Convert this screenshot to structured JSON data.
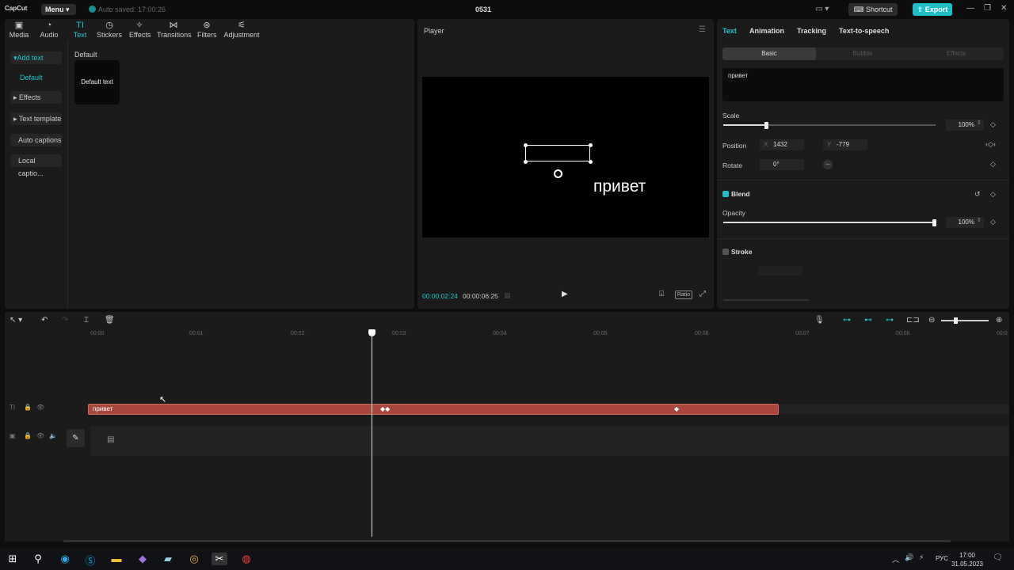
{
  "titlebar": {
    "logo": "CapCut",
    "menu_label": "Menu",
    "autosave": "Auto saved: 17:00:26",
    "project_title": "0531",
    "shortcut_label": "Shortcut",
    "export_label": "Export"
  },
  "toolbar": {
    "items": [
      {
        "label": "Media",
        "icon": "media-icon"
      },
      {
        "label": "Audio",
        "icon": "audio-icon"
      },
      {
        "label": "Text",
        "icon": "text-icon",
        "active": true
      },
      {
        "label": "Stickers",
        "icon": "stickers-icon"
      },
      {
        "label": "Effects",
        "icon": "effects-icon"
      },
      {
        "label": "Transitions",
        "icon": "transitions-icon"
      },
      {
        "label": "Filters",
        "icon": "filters-icon"
      },
      {
        "label": "Adjustment",
        "icon": "adjustment-icon"
      }
    ]
  },
  "categories": {
    "add_text": "Add text",
    "default": "Default",
    "effects": "Effects",
    "text_template": "Text template",
    "auto_captions": "Auto captions",
    "local_captions": "Local captio..."
  },
  "library": {
    "section_label": "Default",
    "card_label": "Default text"
  },
  "player": {
    "title": "Player",
    "preview_text": "привет",
    "current_time": "00:00:02:24",
    "total_time": "00:00:06:25",
    "ratio_label": "Ratio"
  },
  "properties": {
    "tabs": [
      "Text",
      "Animation",
      "Tracking",
      "Text-to-speech"
    ],
    "subtabs": [
      "Basic",
      "Bubble",
      "Effects"
    ],
    "text_value": "привет",
    "scale_label": "Scale",
    "scale_value": "100%",
    "scale_fraction": 0.2,
    "position_label": "Position",
    "pos_x_label": "X",
    "pos_x": "1432",
    "pos_y_label": "Y",
    "pos_y": "-779",
    "rotate_label": "Rotate",
    "rotate_value": "0°",
    "blend_label": "Blend",
    "opacity_label": "Opacity",
    "opacity_value": "100%",
    "stroke_label": "Stroke"
  },
  "timeline": {
    "ticks": [
      "00:00",
      "00:01",
      "00:02",
      "00:03",
      "00:04",
      "00:05",
      "00:06",
      "00:07",
      "00:08",
      "00:0"
    ],
    "clip_label": "привет"
  },
  "taskbar": {
    "language": "РУС",
    "time": "17:00",
    "date": "31.05.2023"
  },
  "colors": {
    "accent": "#1fc5cf",
    "clip": "#a8473c"
  }
}
